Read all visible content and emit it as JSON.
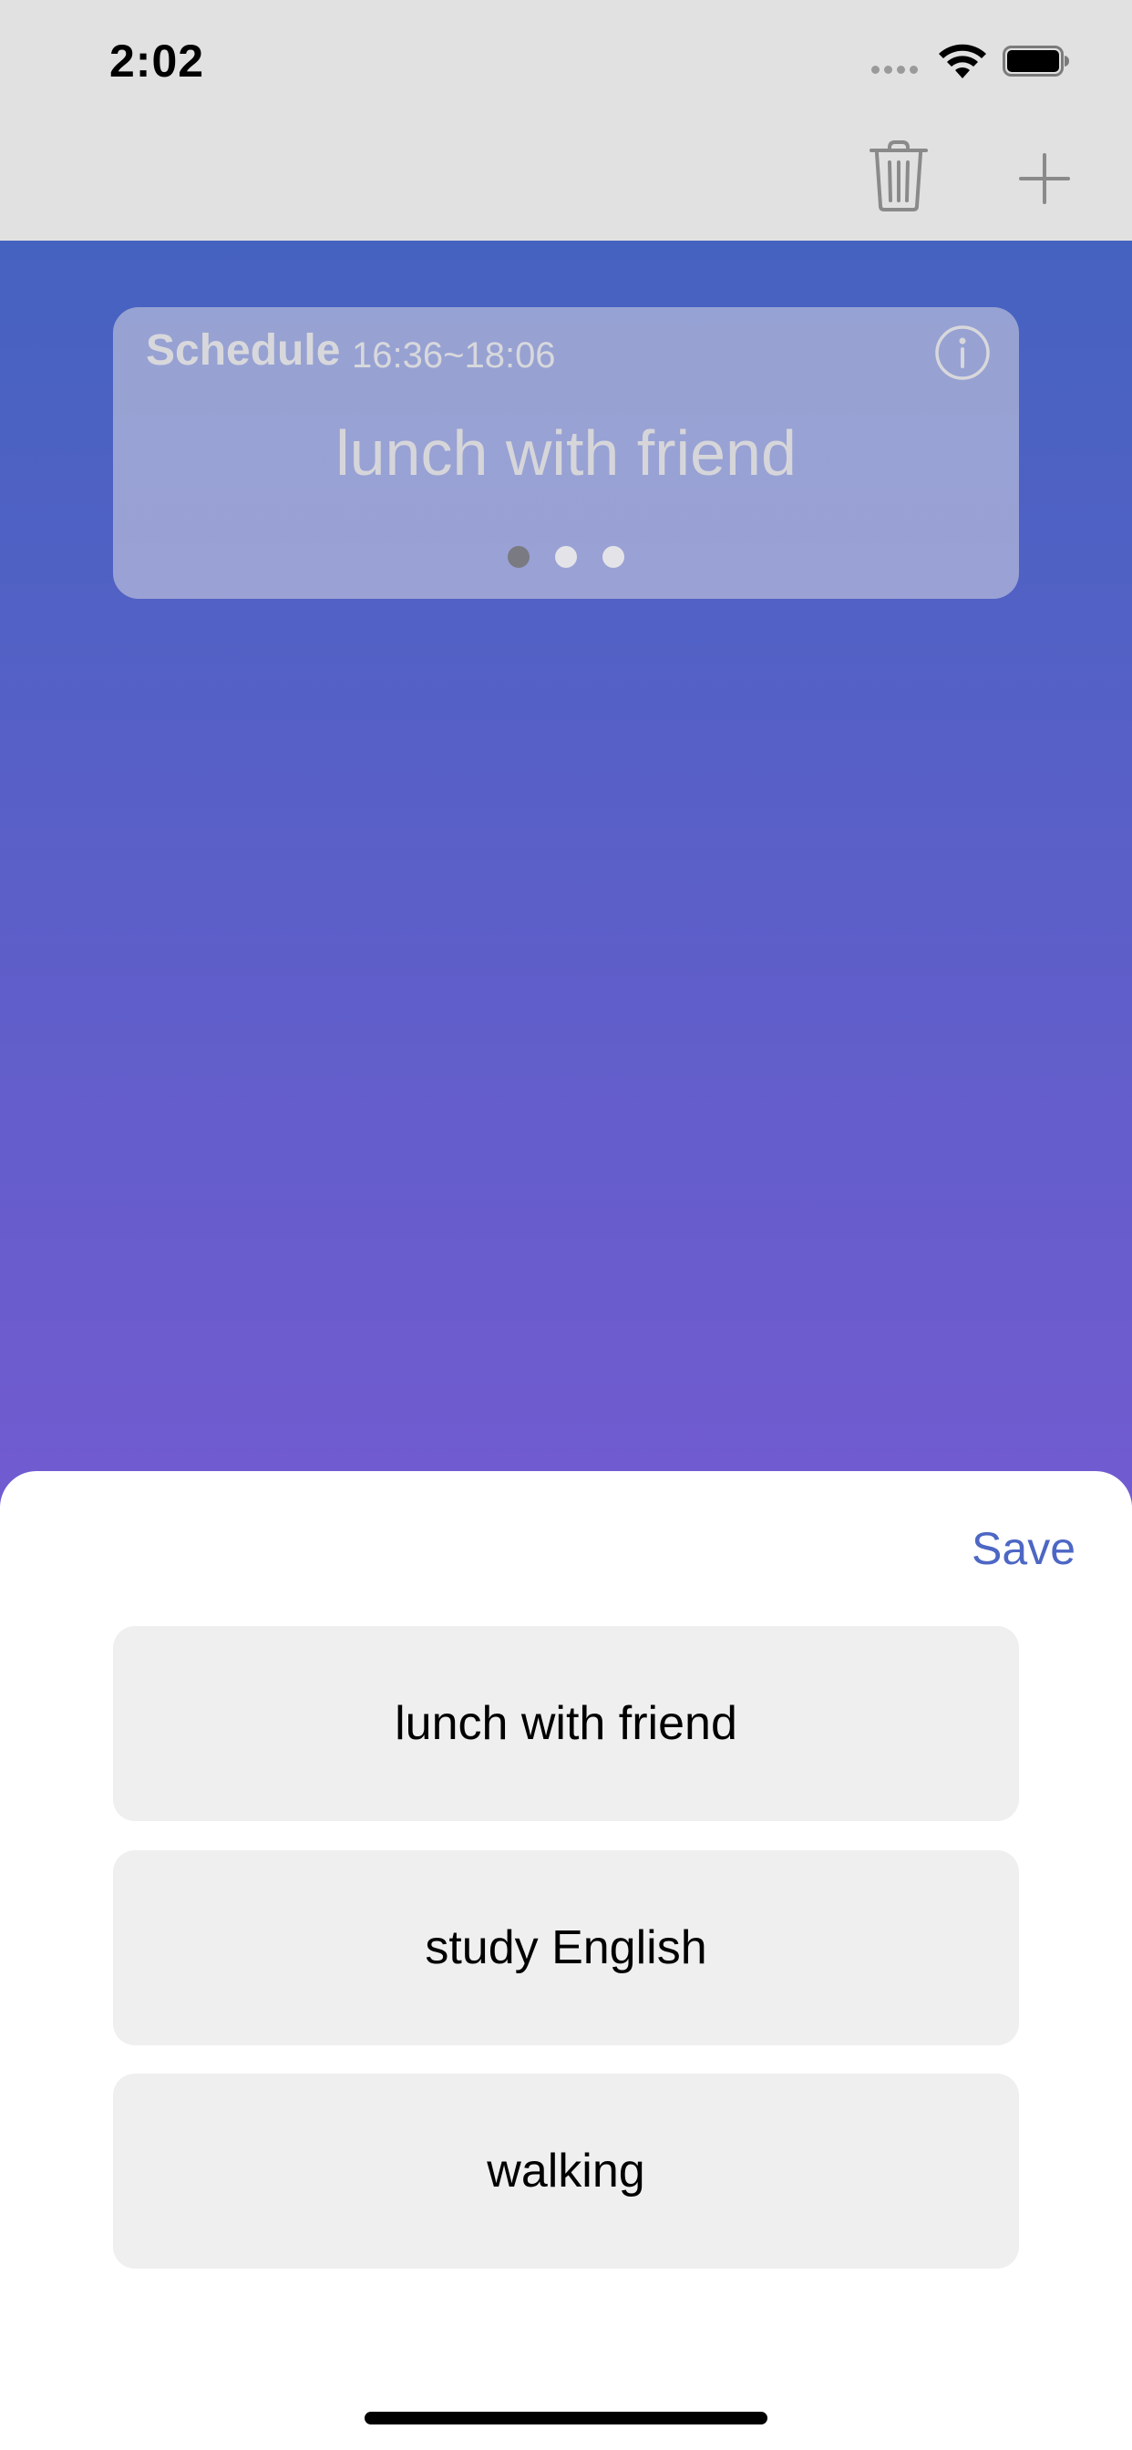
{
  "status_bar": {
    "time": "2:02",
    "signal_icon": "cellular-signal-icon",
    "wifi_icon": "wifi-icon",
    "battery_icon": "battery-icon"
  },
  "nav_bar": {
    "trash_icon": "trash-icon",
    "add_icon": "plus-icon"
  },
  "card": {
    "title": "Schedule",
    "time": "16:36~18:06",
    "info_icon": "info-icon",
    "event": "lunch with friend",
    "page_count": 3,
    "active_page": 1
  },
  "sheet": {
    "save_label": "Save",
    "options": [
      "lunch with friend",
      "study English",
      "walking"
    ]
  },
  "colors": {
    "accent": "#4d67c4",
    "gradient_top": "#4662c0",
    "gradient_bottom": "#725bd1",
    "nav_background": "#e1e1e1",
    "option_background": "#efefef"
  }
}
